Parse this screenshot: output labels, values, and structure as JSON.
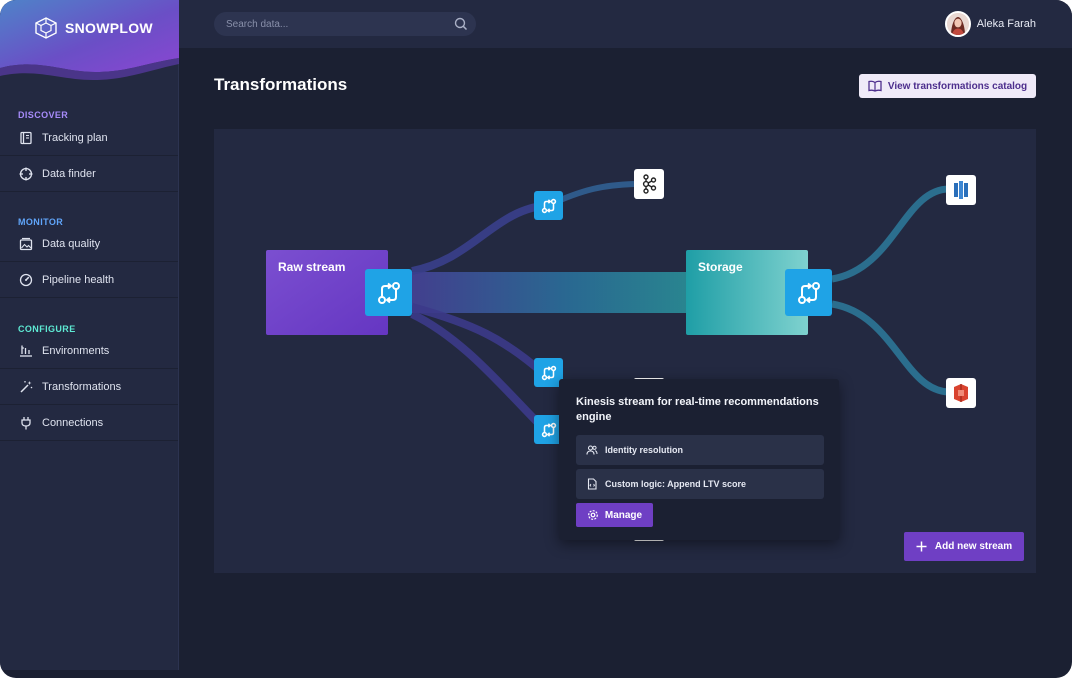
{
  "brand": {
    "name": "SNOWPLOW",
    "logo_icon": "snowplow-logo-icon"
  },
  "sidebar": {
    "sections": [
      {
        "label": "DISCOVER",
        "color": "#a78bfa",
        "items": [
          {
            "label": "Tracking plan",
            "icon": "notebook-icon"
          },
          {
            "label": "Data finder",
            "icon": "crosshair-icon"
          }
        ]
      },
      {
        "label": "MONITOR",
        "color": "#60a5fa",
        "items": [
          {
            "label": "Data quality",
            "icon": "image-stack-icon"
          },
          {
            "label": "Pipeline health",
            "icon": "gauge-icon"
          }
        ]
      },
      {
        "label": "CONFIGURE",
        "color": "#5eead4",
        "items": [
          {
            "label": "Environments",
            "icon": "environments-icon"
          },
          {
            "label": "Transformations",
            "icon": "magic-wand-icon"
          },
          {
            "label": "Connections",
            "icon": "plug-icon"
          }
        ]
      }
    ]
  },
  "topbar": {
    "search_placeholder": "Search data...",
    "user_name": "Aleka Farah"
  },
  "main": {
    "title": "Transformations",
    "catalog_button": "View transformations catalog",
    "add_stream_button": "Add new stream"
  },
  "graph": {
    "nodes": {
      "raw_stream": {
        "label": "Raw stream"
      },
      "storage": {
        "label": "Storage"
      }
    },
    "destinations": [
      "kafka-icon",
      "redshift-icon",
      "s3-icon"
    ]
  },
  "popover": {
    "title": "Kinesis stream for real-time recommendations engine",
    "items": [
      {
        "label": "Identity resolution",
        "icon": "users-icon"
      },
      {
        "label": "Custom logic: Append LTV score",
        "icon": "file-code-icon"
      }
    ],
    "manage_button": "Manage"
  },
  "colors": {
    "accent": "#6f3fc4",
    "transform_blue": "#1fa3e6",
    "raw_stream_purple": "#7b4fd0",
    "storage_teal": "#2bb3b8"
  }
}
